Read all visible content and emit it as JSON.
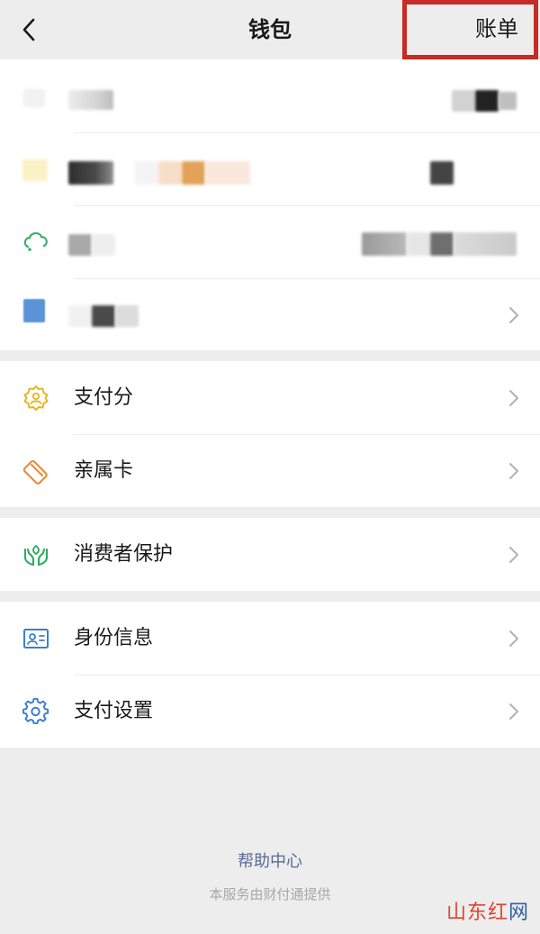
{
  "header": {
    "title": "钱包",
    "bill_label": "账单"
  },
  "section_2": {
    "items": [
      {
        "label": "支付分",
        "icon": "payment-score-icon"
      },
      {
        "label": "亲属卡",
        "icon": "family-card-icon"
      }
    ]
  },
  "section_3": {
    "items": [
      {
        "label": "消费者保护",
        "icon": "consumer-protection-icon"
      }
    ]
  },
  "section_4": {
    "items": [
      {
        "label": "身份信息",
        "icon": "id-card-icon"
      },
      {
        "label": "支付设置",
        "icon": "gear-icon"
      }
    ]
  },
  "footer": {
    "help_center": "帮助中心",
    "provider": "本服务由财付通提供"
  },
  "watermark": {
    "part_a": "山东红",
    "part_b": "网"
  },
  "colors": {
    "highlight_border": "#c62b26",
    "link": "#576b95",
    "payment_score_icon": "#e9b422",
    "family_card_icon": "#e58c3e",
    "consumer_protection_icon": "#2bab5d",
    "id_card_icon": "#3b7fd1",
    "gear_icon": "#3b7fd1"
  }
}
